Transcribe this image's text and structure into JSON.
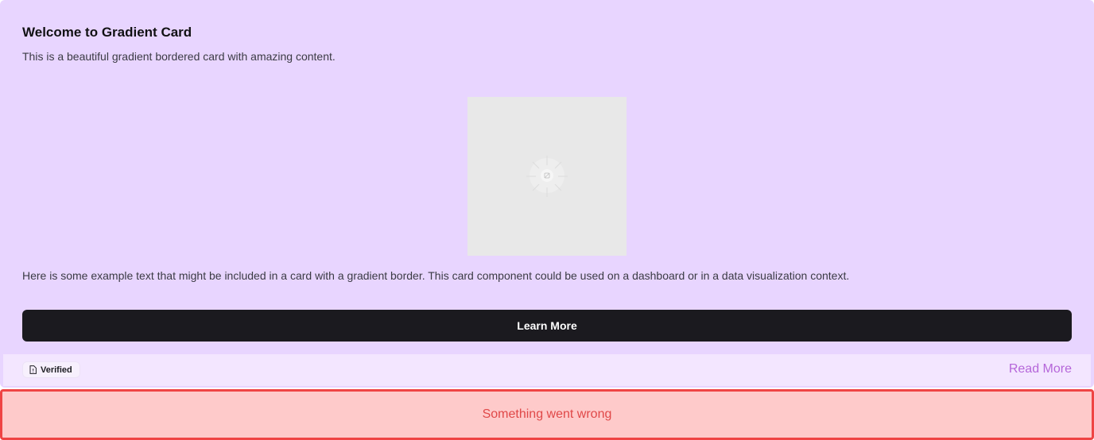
{
  "card": {
    "title": "Welcome to Gradient Card",
    "description": "This is a beautiful gradient bordered card with amazing content.",
    "body_text": "Here is some example text that might be included in a card with a gradient border. This card component could be used on a dashboard or in a data visualization context.",
    "button_label": "Learn More",
    "image_icon": "image-placeholder-icon",
    "colors": {
      "background": "#e8d5ff",
      "footer": "#f3e6ff",
      "button": "#1b1a1f",
      "link": "#b566d9"
    }
  },
  "footer": {
    "badge_label": "Verified",
    "badge_icon": "file-alert-icon",
    "link_label": "Read More"
  },
  "error": {
    "message": "Something went wrong",
    "colors": {
      "background": "#fecaca",
      "border": "#ef4444",
      "text": "#e04848"
    }
  }
}
